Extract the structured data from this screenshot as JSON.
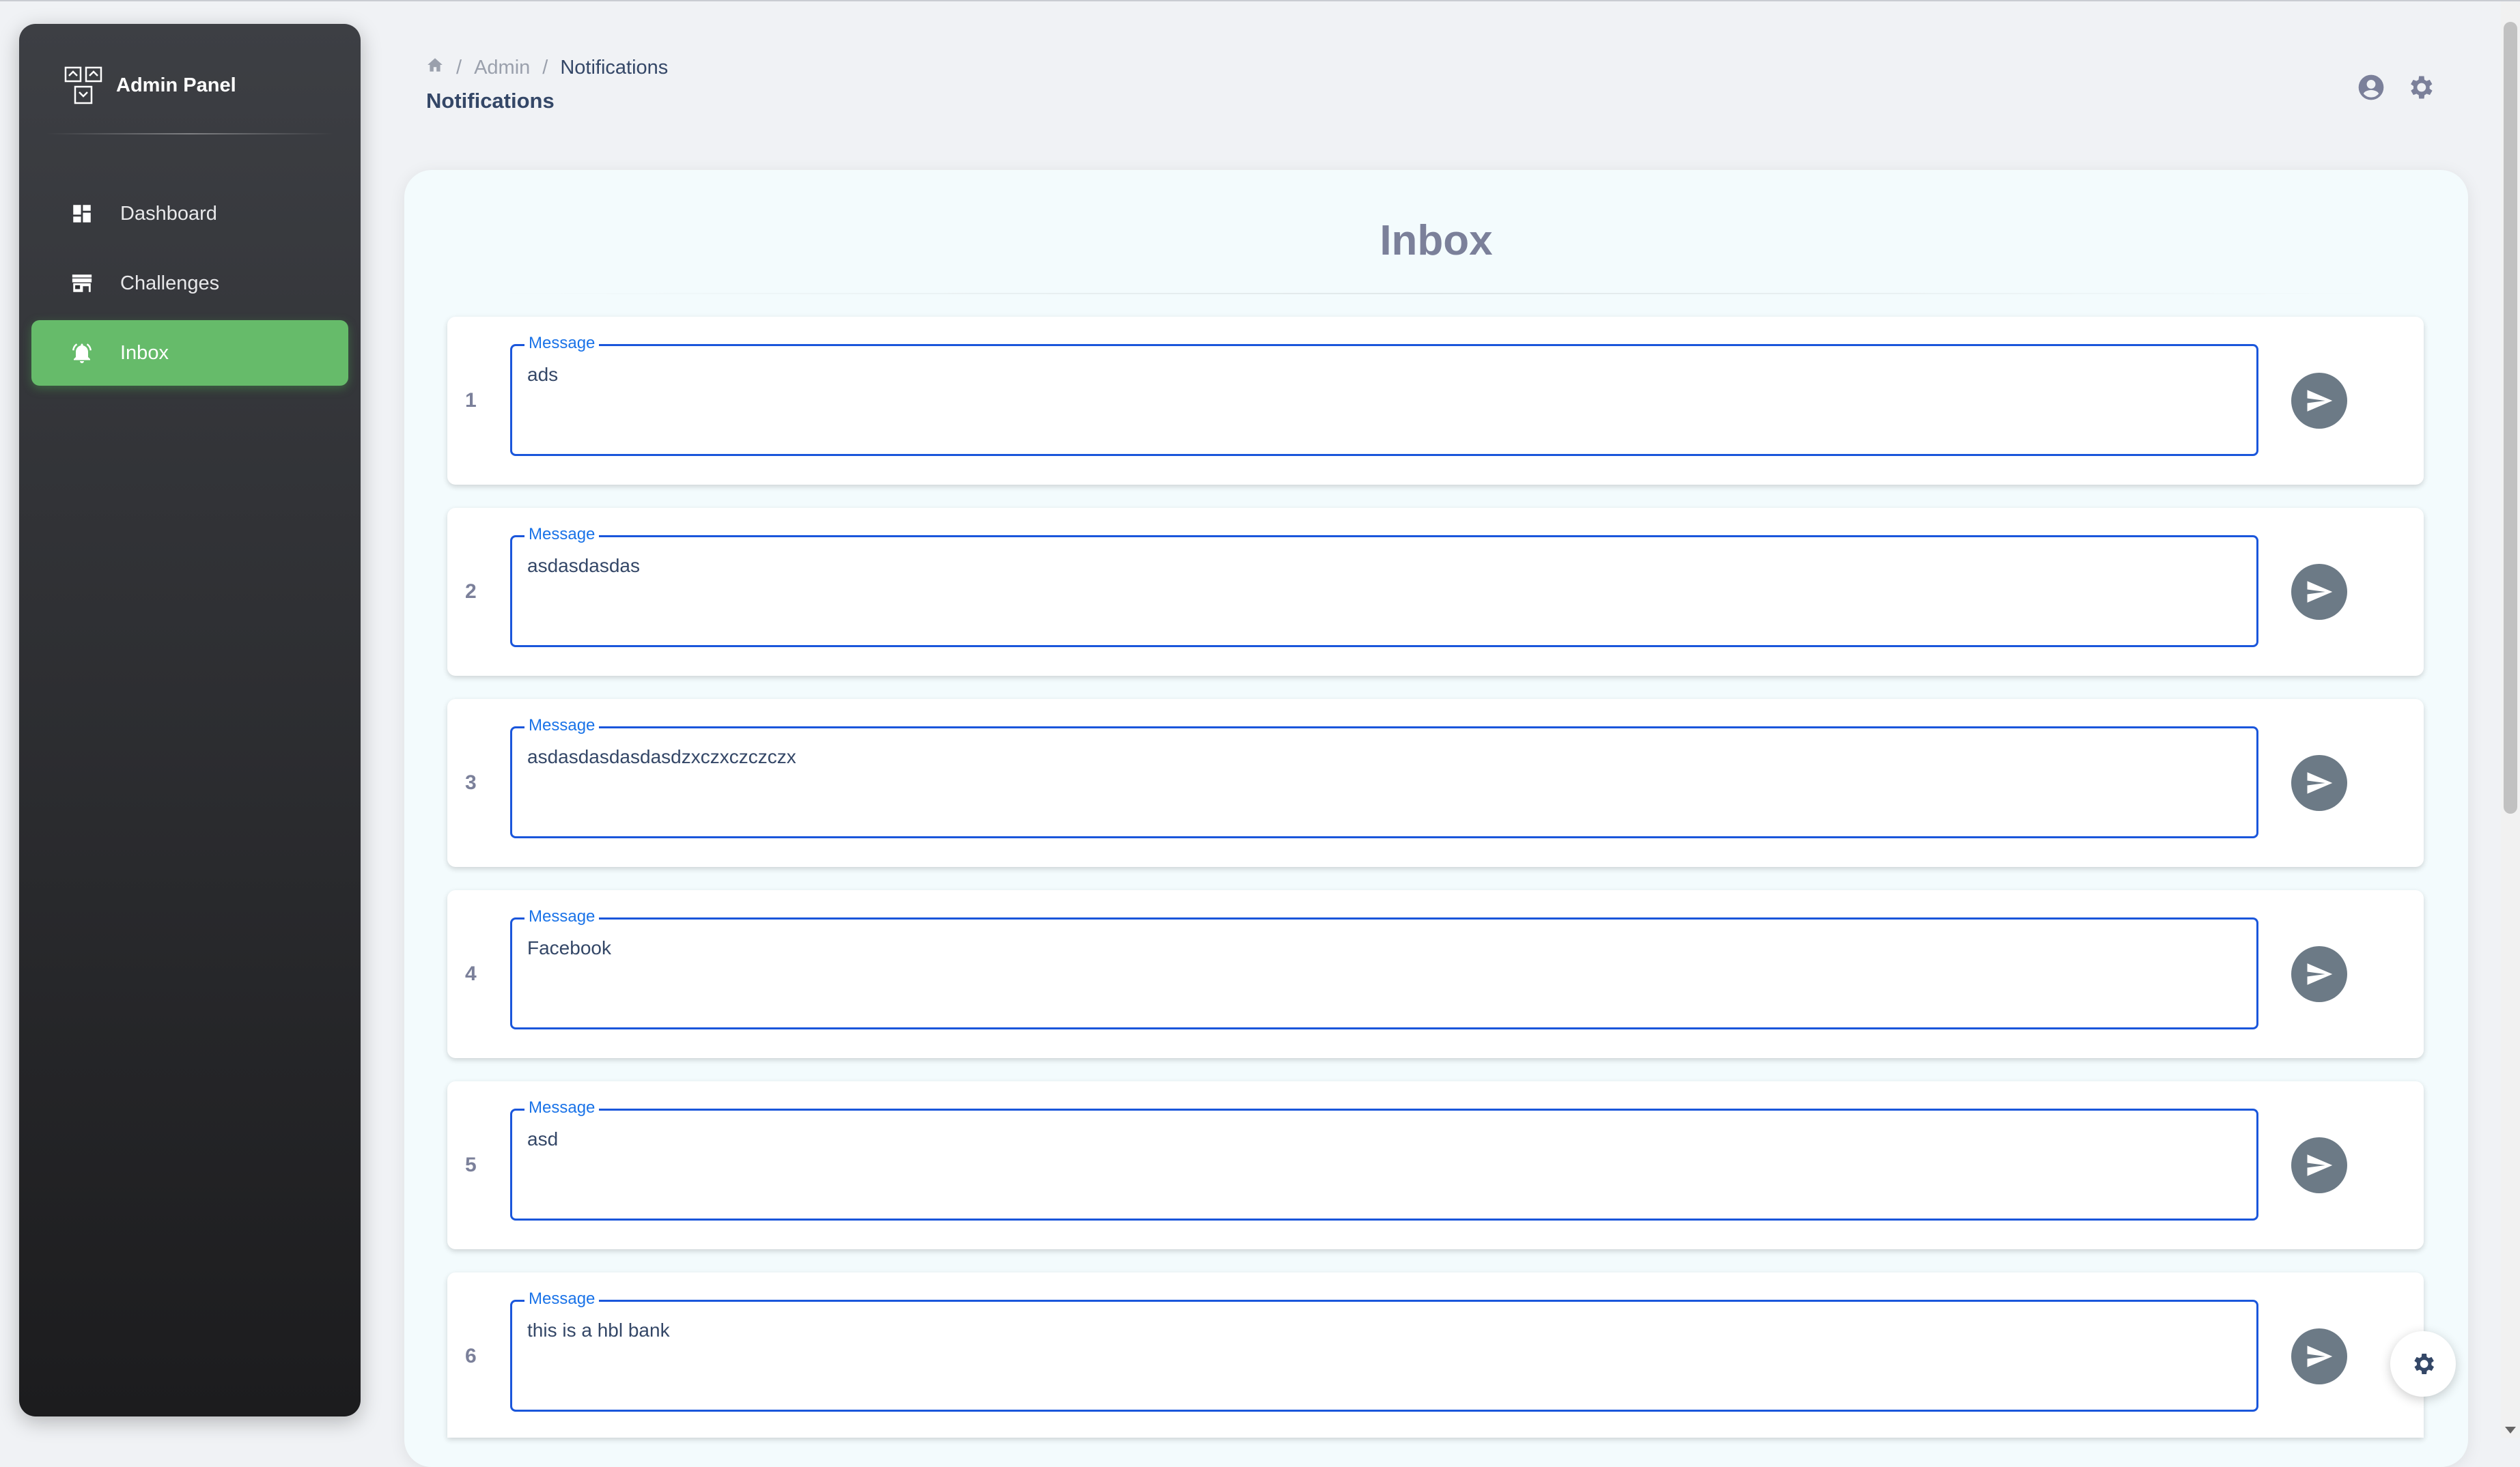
{
  "sidebar": {
    "brand": "Admin Panel",
    "items": [
      {
        "label": "Dashboard",
        "icon": "dashboard-icon"
      },
      {
        "label": "Challenges",
        "icon": "store-icon"
      },
      {
        "label": "Inbox",
        "icon": "notifications-icon",
        "active": true
      }
    ],
    "active_color": "#66bb6a"
  },
  "header": {
    "breadcrumb": [
      "Admin",
      "Notifications"
    ],
    "title": "Notifications"
  },
  "inbox": {
    "title": "Inbox",
    "field_label": "Message",
    "rows": [
      {
        "index": "1",
        "message": "ads"
      },
      {
        "index": "2",
        "message": "asdasdasdas"
      },
      {
        "index": "3",
        "message": "asdasdasdasdasdzxczxczczczx"
      },
      {
        "index": "4",
        "message": "Facebook"
      },
      {
        "index": "5",
        "message": "asd"
      },
      {
        "index": "6",
        "message": "this is a hbl bank"
      }
    ]
  },
  "colors": {
    "accent": "#1a56db",
    "send_button": "#6c7a86"
  }
}
